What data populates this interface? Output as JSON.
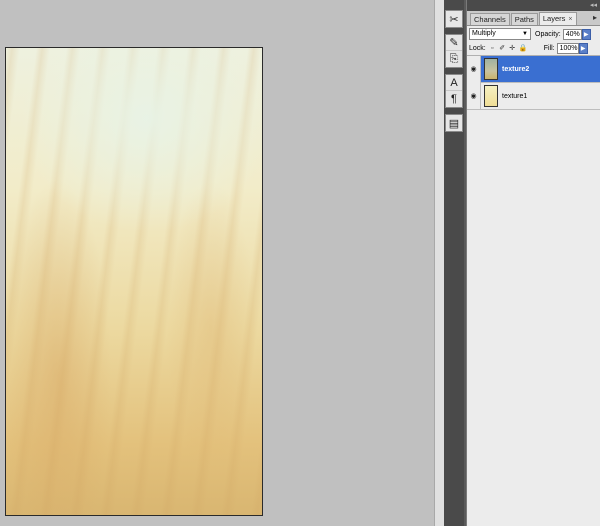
{
  "panel": {
    "tabs": [
      {
        "label": "Channels"
      },
      {
        "label": "Paths"
      },
      {
        "label": "Layers"
      }
    ],
    "tab_close": "×",
    "menu_icon": "▸",
    "blend_mode": "Multiply",
    "opacity_label": "Opacity:",
    "opacity_value": "40%",
    "lock_label": "Lock:",
    "fill_label": "Fill:",
    "fill_value": "100%"
  },
  "layers": [
    {
      "name": "texture2",
      "selected": true
    },
    {
      "name": "texture1",
      "selected": false
    }
  ],
  "tools": [
    "tool-presets-icon",
    "brush-icon",
    "clone-source-icon",
    "character-icon",
    "paragraph-icon",
    "layer-comps-icon"
  ],
  "colors": {
    "selection": "#3a6fd1",
    "workspace": "#c0c0c0",
    "panel_bg": "#ececec"
  }
}
